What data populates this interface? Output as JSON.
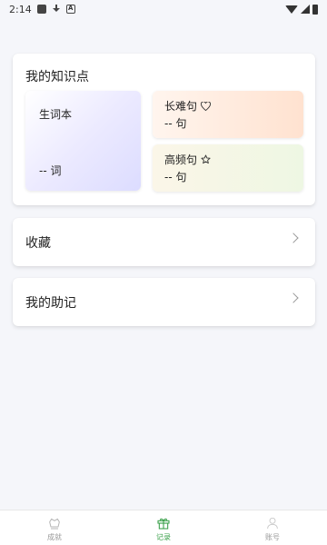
{
  "status_bar": {
    "time": "2:14",
    "icons": [
      "app-square-icon",
      "download-icon",
      "a-icon",
      "wifi-icon",
      "signal-icon",
      "battery-icon"
    ]
  },
  "knowledge": {
    "title": "我的知识点",
    "vocab": {
      "title": "生词本",
      "count": "-- 词"
    },
    "hard_sentences": {
      "title": "长难句",
      "icon": "heart-icon",
      "count": "-- 句"
    },
    "frequent_sentences": {
      "title": "高频句",
      "icon": "star-icon",
      "count": "-- 句"
    }
  },
  "favorites": {
    "label": "收藏"
  },
  "mnemonics": {
    "label": "我的助记"
  },
  "bottom_nav": {
    "active": "record",
    "items": [
      {
        "label": "成就",
        "icon": "trophy-icon"
      },
      {
        "label": "记录",
        "icon": "gift-icon"
      },
      {
        "label": "账号",
        "icon": "user-icon"
      }
    ]
  },
  "colors": {
    "accent": "#3aa04a",
    "background": "#f5f6fa",
    "vocab_tile": "#dcdcff",
    "hard_tile": "#ffe2d0",
    "freq_tile": "#eef7e3"
  }
}
